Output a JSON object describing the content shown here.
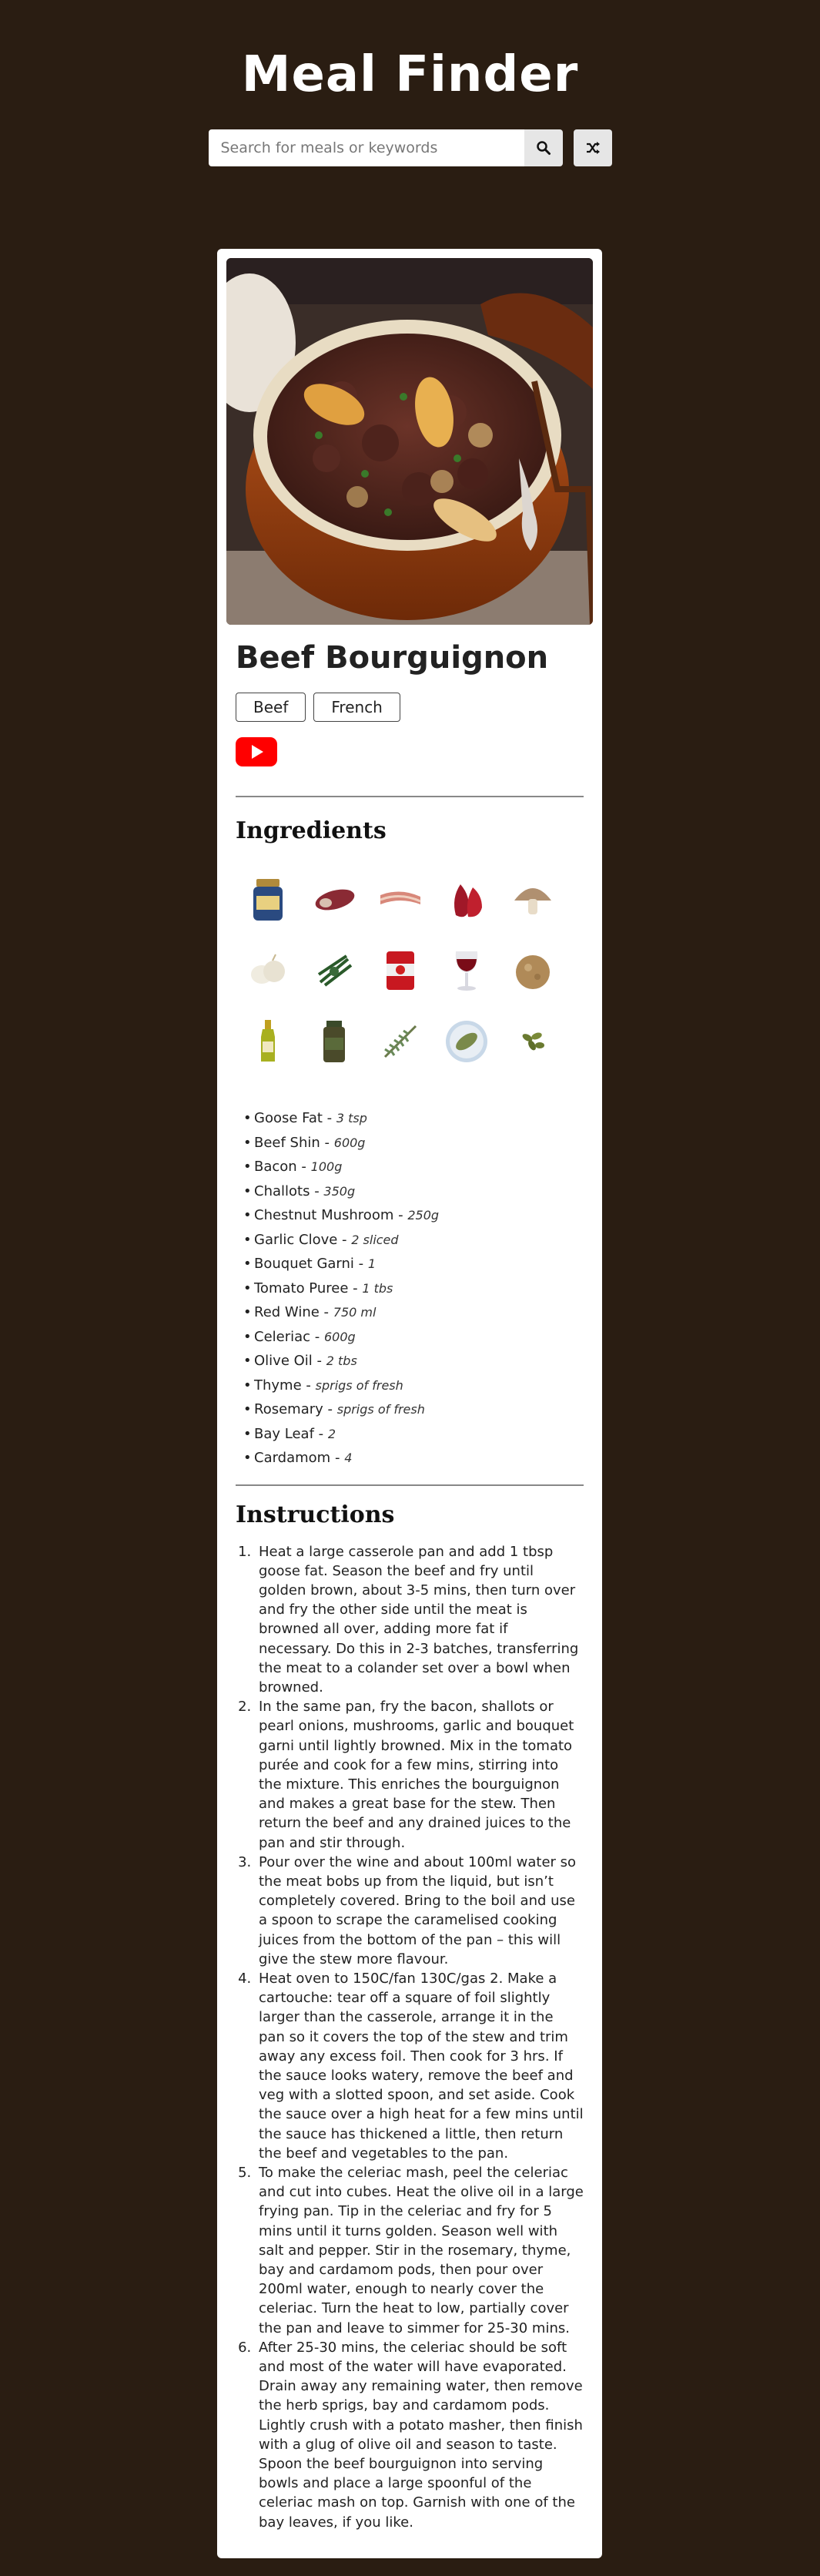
{
  "app": {
    "title": "Meal Finder"
  },
  "search": {
    "placeholder": "Search for meals or keywords",
    "value": "",
    "search_icon": "search-icon",
    "random_icon": "shuffle-icon"
  },
  "meal": {
    "name": "Beef Bourguignon",
    "tags": [
      "Beef",
      "French"
    ],
    "youtube_icon": "youtube-icon",
    "ingredients_title": "Ingredients",
    "ingredients": [
      {
        "name": "Goose Fat",
        "measure": "3 tsp"
      },
      {
        "name": "Beef Shin",
        "measure": "600g"
      },
      {
        "name": "Bacon",
        "measure": "100g"
      },
      {
        "name": "Challots",
        "measure": "350g"
      },
      {
        "name": "Chestnut Mushroom",
        "measure": "250g"
      },
      {
        "name": "Garlic Clove",
        "measure": "2 sliced"
      },
      {
        "name": "Bouquet Garni",
        "measure": "1"
      },
      {
        "name": "Tomato Puree",
        "measure": "1 tbs"
      },
      {
        "name": "Red Wine",
        "measure": "750 ml"
      },
      {
        "name": "Celeriac",
        "measure": "600g"
      },
      {
        "name": "Olive Oil",
        "measure": "2 tbs"
      },
      {
        "name": "Thyme",
        "measure": "sprigs of fresh"
      },
      {
        "name": "Rosemary",
        "measure": "sprigs of fresh"
      },
      {
        "name": "Bay Leaf",
        "measure": "2"
      },
      {
        "name": "Cardamom",
        "measure": "4"
      }
    ],
    "instructions_title": "Instructions",
    "instructions": [
      "Heat a large casserole pan and add 1 tbsp goose fat. Season the beef and fry until golden brown, about 3-5 mins, then turn over and fry the other side until the meat is browned all over, adding more fat if necessary. Do this in 2-3 batches, transferring the meat to a colander set over a bowl when browned.",
      "In the same pan, fry the bacon, shallots or pearl onions, mushrooms, garlic and bouquet garni until lightly browned. Mix in the tomato purée and cook for a few mins, stirring into the mixture. This enriches the bourguignon and makes a great base for the stew. Then return the beef and any drained juices to the pan and stir through.",
      "Pour over the wine and about 100ml water so the meat bobs up from the liquid, but isn’t completely covered. Bring to the boil and use a spoon to scrape the caramelised cooking juices from the bottom of the pan – this will give the stew more flavour.",
      "Heat oven to 150C/fan 130C/gas 2. Make a cartouche: tear off a square of foil slightly larger than the casserole, arrange it in the pan so it covers the top of the stew and trim away any excess foil. Then cook for 3 hrs. If the sauce looks watery, remove the beef and veg with a slotted spoon, and set aside. Cook the sauce over a high heat for a few mins until the sauce has thickened a little, then return the beef and vegetables to the pan.",
      "To make the celeriac mash, peel the celeriac and cut into cubes. Heat the olive oil in a large frying pan. Tip in the celeriac and fry for 5 mins until it turns golden. Season well with salt and pepper. Stir in the rosemary, thyme, bay and cardamom pods, then pour over 200ml water, enough to nearly cover the celeriac. Turn the heat to low, partially cover the pan and leave to simmer for 25-30 mins.",
      "After 25-30 mins, the celeriac should be soft and most of the water will have evaporated. Drain away any remaining water, then remove the herb sprigs, bay and cardamom pods. Lightly crush with a potato masher, then finish with a glug of olive oil and season to taste. Spoon the beef bourguignon into serving bowls and place a large spoonful of the celeriac mash on top. Garnish with one of the bay leaves, if you like."
    ]
  },
  "colors": {
    "background": "#2a1d12",
    "card": "#ffffff",
    "youtube_red": "#ff0000"
  }
}
